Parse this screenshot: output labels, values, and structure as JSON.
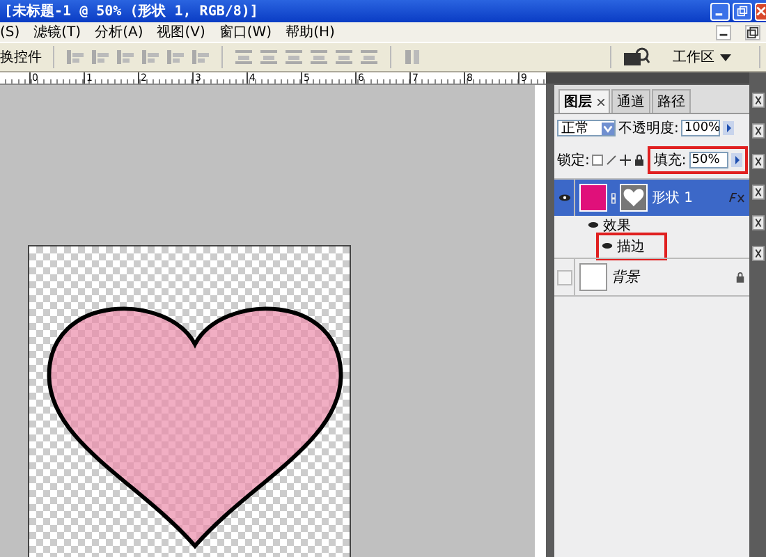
{
  "window": {
    "title": "[未标题-1 @ 50% (形状 1, RGB/8)]"
  },
  "menu": [
    "(S)",
    "滤镜(T)",
    "分析(A)",
    "视图(V)",
    "窗口(W)",
    "帮助(H)"
  ],
  "toolbar": {
    "left_label": "换控件",
    "workspace": "工作区"
  },
  "ruler": {
    "ticks": [
      "0",
      "1",
      "2",
      "3",
      "4",
      "5",
      "6",
      "7",
      "8",
      "9"
    ]
  },
  "layers_panel": {
    "tabs": [
      {
        "label": "图层",
        "selected": true,
        "closable": true
      },
      {
        "label": "通道",
        "selected": false,
        "closable": false
      },
      {
        "label": "路径",
        "selected": false,
        "closable": false
      }
    ],
    "blend_mode": "正常",
    "opacity_label": "不透明度:",
    "opacity": "100%",
    "lock_label": "锁定:",
    "fill_label": "填充:",
    "fill": "50%",
    "fill_highlighted": true,
    "layers": [
      {
        "kind": "shape",
        "name": "形状 1",
        "selected": true,
        "visible": true,
        "effects_label": "效果",
        "effects": [
          {
            "name": "描边",
            "visible": true,
            "highlighted": true
          }
        ]
      },
      {
        "kind": "background",
        "name": "背景",
        "selected": false,
        "visible": false,
        "locked": true
      }
    ]
  }
}
